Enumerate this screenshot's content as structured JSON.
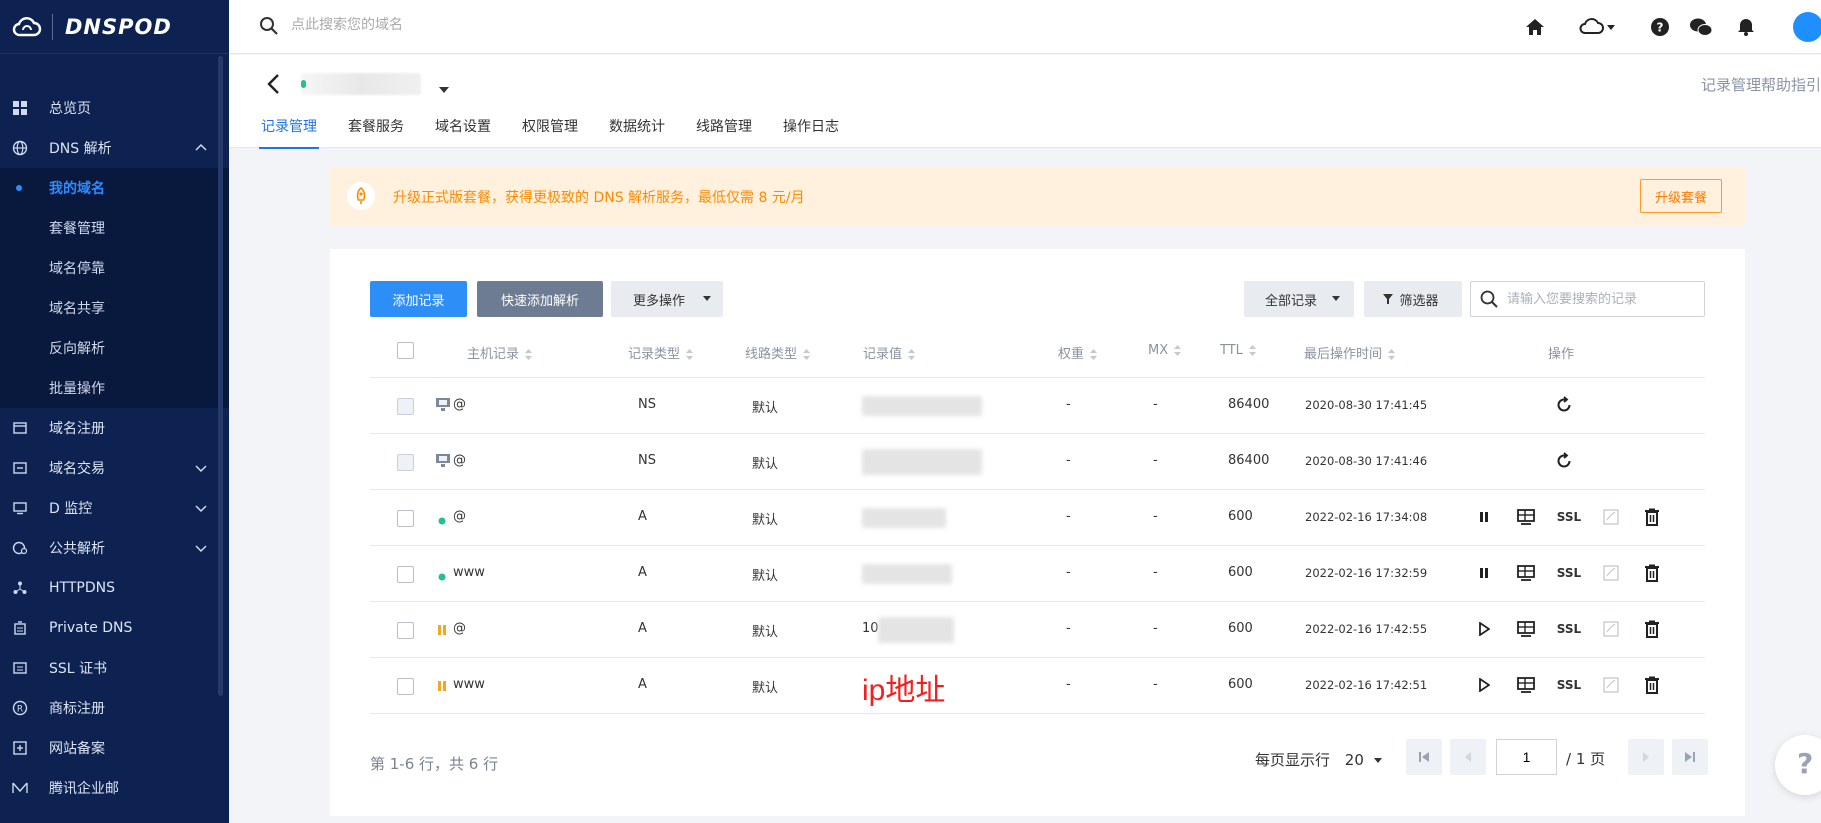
{
  "brand": {
    "name": "DNSPOD"
  },
  "sidebar": {
    "items": [
      {
        "label": "总览页",
        "icon": "dashboard-icon"
      },
      {
        "label": "DNS 解析",
        "icon": "globe-icon",
        "expanded": true
      },
      {
        "label": "域名注册",
        "icon": "register-icon"
      },
      {
        "label": "域名交易",
        "icon": "trade-icon"
      },
      {
        "label": "D 监控",
        "icon": "monitor-icon"
      },
      {
        "label": "公共解析",
        "icon": "public-dns-icon"
      },
      {
        "label": "HTTPDNS",
        "icon": "httpdns-icon"
      },
      {
        "label": "Private DNS",
        "icon": "private-dns-icon"
      },
      {
        "label": "SSL 证书",
        "icon": "ssl-cert-icon"
      },
      {
        "label": "商标注册",
        "icon": "trademark-icon"
      },
      {
        "label": "网站备案",
        "icon": "icp-icon"
      },
      {
        "label": "腾讯企业邮",
        "icon": "mail-icon"
      }
    ],
    "sub_items": [
      {
        "label": "我的域名",
        "active": true
      },
      {
        "label": "套餐管理"
      },
      {
        "label": "域名停靠"
      },
      {
        "label": "域名共享"
      },
      {
        "label": "反向解析"
      },
      {
        "label": "批量操作"
      }
    ]
  },
  "topbar": {
    "search_placeholder": "点此搜索您的域名"
  },
  "header": {
    "help_link": "记录管理帮助指引",
    "tabs": [
      "记录管理",
      "套餐服务",
      "域名设置",
      "权限管理",
      "数据统计",
      "线路管理",
      "操作日志"
    ],
    "active_tab": 0
  },
  "promo": {
    "text": "升级正式版套餐，获得更极致的 DNS 解析服务，最低仅需 8 元/月",
    "button": "升级套餐"
  },
  "toolbar": {
    "add": "添加记录",
    "quick_add": "快速添加解析",
    "more": "更多操作",
    "all_records": "全部记录",
    "filter": "筛选器",
    "search_placeholder": "请输入您要搜索的记录"
  },
  "table": {
    "headers": {
      "host": "主机记录",
      "type": "记录类型",
      "line": "线路类型",
      "value": "记录值",
      "weight": "权重",
      "mx": "MX",
      "ttl": "TTL",
      "time": "最后操作时间",
      "actions": "操作"
    },
    "rows": [
      {
        "status": "system",
        "host": "@",
        "type": "NS",
        "line": "默认",
        "value": "",
        "weight": "-",
        "mx": "-",
        "ttl": "86400",
        "time": "2020-08-30 17:41:45"
      },
      {
        "status": "system",
        "host": "@",
        "type": "NS",
        "line": "默认",
        "value": "",
        "weight": "-",
        "mx": "-",
        "ttl": "86400",
        "time": "2020-08-30 17:41:46"
      },
      {
        "status": "enabled",
        "host": "@",
        "type": "A",
        "line": "默认",
        "value": "",
        "weight": "-",
        "mx": "-",
        "ttl": "600",
        "time": "2022-02-16 17:34:08"
      },
      {
        "status": "enabled",
        "host": "www",
        "type": "A",
        "line": "默认",
        "value": "",
        "weight": "-",
        "mx": "-",
        "ttl": "600",
        "time": "2022-02-16 17:32:59"
      },
      {
        "status": "paused",
        "host": "@",
        "type": "A",
        "line": "默认",
        "value": "10",
        "weight": "-",
        "mx": "-",
        "ttl": "600",
        "time": "2022-02-16 17:42:55"
      },
      {
        "status": "paused",
        "host": "www",
        "type": "A",
        "line": "默认",
        "value": "",
        "weight": "-",
        "mx": "-",
        "ttl": "600",
        "time": "2022-02-16 17:42:51"
      }
    ],
    "ssl_label": "SSL",
    "annotation": "ip地址"
  },
  "pagination": {
    "summary": "第 1-6 行，共 6 行",
    "per_page_label": "每页显示行",
    "per_page": "20",
    "current_page": "1",
    "total_label": "/ 1 页"
  },
  "colors": {
    "sidebar_bg": "#0d2250",
    "primary": "#2e8ef7",
    "promo_bg": "#fff1de",
    "promo_text": "#ff8a00",
    "enabled": "#26c18a",
    "paused": "#f5a623"
  }
}
